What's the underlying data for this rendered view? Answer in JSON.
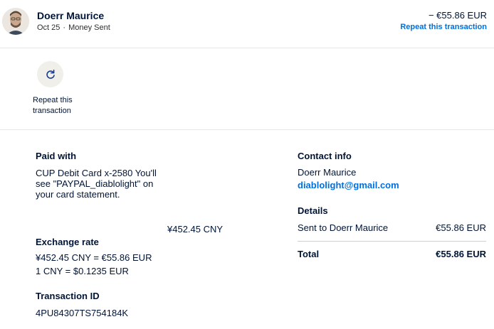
{
  "header": {
    "name": "Doerr Maurice",
    "date": "Oct 25",
    "separator": "·",
    "type": "Money Sent",
    "amount": "− €55.86 EUR",
    "repeat_link": "Repeat this transaction"
  },
  "repeat_action": {
    "label": "Repeat this transaction",
    "icon": "refresh-icon"
  },
  "paid_with": {
    "heading": "Paid with",
    "card_text": "CUP Debit Card x-2580 You'll see \"PAYPAL_diablolight\" on your card statement.",
    "amount_cny": "¥452.45 CNY"
  },
  "exchange_rate": {
    "heading": "Exchange rate",
    "line1": "¥452.45 CNY = €55.86 EUR",
    "line2": "1 CNY = $0.1235 EUR"
  },
  "transaction": {
    "heading": "Transaction ID",
    "id": "4PU84307TS754184K"
  },
  "contact": {
    "heading": "Contact info",
    "name": "Doerr Maurice",
    "email": "diablolight@gmail.com"
  },
  "details": {
    "heading": "Details",
    "sent_to_label": "Sent to Doerr Maurice",
    "sent_to_amount": "€55.86 EUR",
    "total_label": "Total",
    "total_amount": "€55.86 EUR"
  },
  "colors": {
    "text": "#001435",
    "link": "#0070e0",
    "icon_bg": "#f1efea",
    "divider": "#e6e6e6"
  }
}
